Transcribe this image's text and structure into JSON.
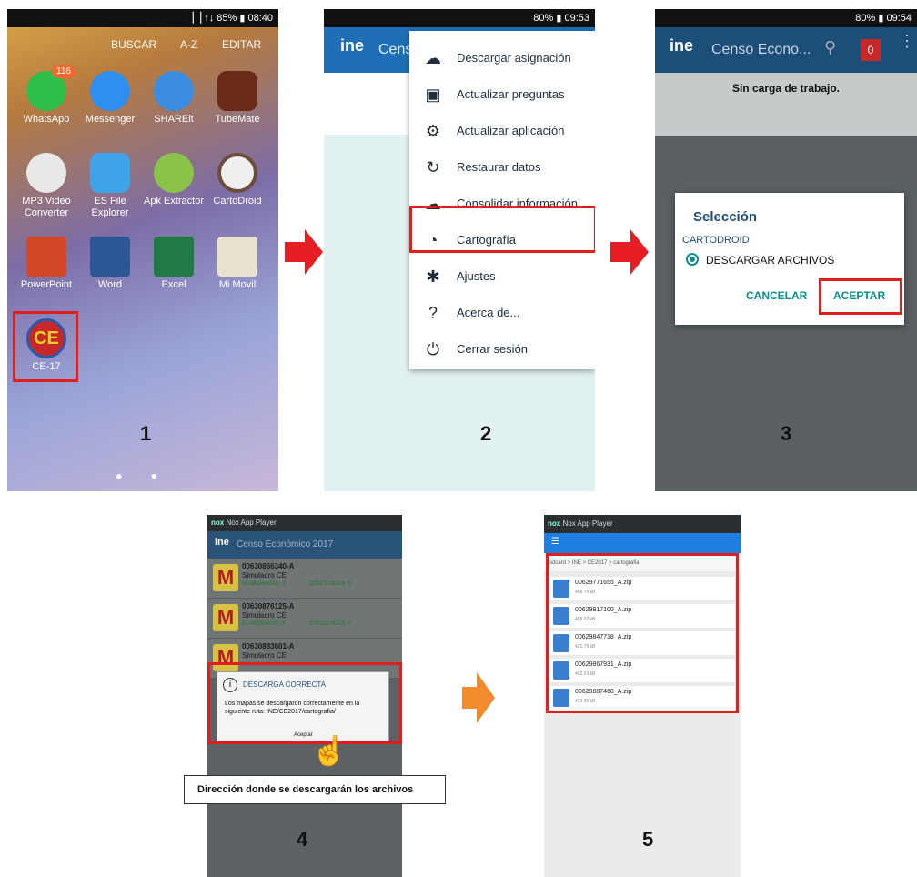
{
  "panel1": {
    "status": "▕▕ ↑↓ 85% ▮ 08:40",
    "topbar": {
      "buscar": "BUSCAR",
      "az": "A-Z",
      "editar": "EDITAR"
    },
    "apps": [
      {
        "label": "WhatsApp",
        "icon": "whatsapp-icon",
        "badge": "116"
      },
      {
        "label": "Messenger",
        "icon": "messenger-icon"
      },
      {
        "label": "SHAREit",
        "icon": "shareit-icon"
      },
      {
        "label": "TubeMate",
        "icon": "tubemate-icon"
      },
      {
        "label": "MP3 Video Converter",
        "icon": "mp3-converter-icon"
      },
      {
        "label": "ES File Explorer",
        "icon": "es-file-explorer-icon"
      },
      {
        "label": "Apk Extractor",
        "icon": "apk-extractor-icon"
      },
      {
        "label": "CartoDroid",
        "icon": "cartodroid-icon"
      },
      {
        "label": "PowerPoint",
        "icon": "powerpoint-icon"
      },
      {
        "label": "Word",
        "icon": "word-icon"
      },
      {
        "label": "Excel",
        "icon": "excel-icon"
      },
      {
        "label": "Mi Movil",
        "icon": "mi-movil-icon"
      }
    ],
    "ce_app": {
      "label": "CE-17",
      "icon_text": "CE"
    },
    "step": "1"
  },
  "panel2": {
    "status": "80% ▮ 09:53",
    "app_title": "Cens",
    "menu": [
      {
        "label": "Descargar asignación",
        "icon": "☁"
      },
      {
        "label": "Actualizar preguntas",
        "icon": "▣"
      },
      {
        "label": "Actualizar aplicación",
        "icon": "⚙"
      },
      {
        "label": "Restaurar datos",
        "icon": "↻"
      },
      {
        "label": "Consolidar información",
        "icon": "☁"
      },
      {
        "label": "Cartografía",
        "icon": "◔"
      },
      {
        "label": "Ajustes",
        "icon": "✱"
      },
      {
        "label": "Acerca de...",
        "icon": "?"
      },
      {
        "label": "Cerrar sesión",
        "icon": "⏻"
      }
    ],
    "step": "2"
  },
  "panel3": {
    "status": "80% ▮ 09:54",
    "app_title": "Censo Econo...",
    "counter": "0",
    "empty_text": "Sin carga de trabajo.",
    "dialog": {
      "title": "Selección",
      "subtitle": "CARTODROID",
      "option": "DESCARGAR ARCHIVOS",
      "cancel": "CANCELAR",
      "accept": "ACEPTAR"
    },
    "step": "3"
  },
  "panel4": {
    "window_title": "Nox App Player",
    "app_title": "Censo Económico 2017",
    "rows": [
      {
        "code": "00630866340-A",
        "name": "Simulacro CE",
        "elab": "ELABORADAS: 0",
        "concl": "CONCLUIDAS: 0"
      },
      {
        "code": "00630876125-A",
        "name": "Simulacro CE",
        "elab": "ELABORADAS: 0",
        "concl": "CONCLUIDAS: 0"
      },
      {
        "code": "00630883601-A",
        "name": "Simulacro CE",
        "elab": "",
        "concl": ""
      }
    ],
    "dialog": {
      "title": "DESCARGA CORRECTA",
      "body": "Los mapas se descargaron correctamente en la siguiente ruta: INE/CE2017/cartografia/",
      "accept": "Aceptar"
    },
    "step": "4"
  },
  "caption": "Dirección donde se descargarán los archivos",
  "panel5": {
    "window_title": "Nox App Player",
    "path": "sdcard  >  INE  >  CE2017  >  cartografia",
    "files": [
      {
        "name": "00629771655_A.zip",
        "size": "488.74 kB"
      },
      {
        "name": "00629817100_A.zip",
        "size": "459.02 kB"
      },
      {
        "name": "00629847718_A.zip",
        "size": "421.79 kB"
      },
      {
        "name": "00629867931_A.zip",
        "size": "402.53 kB"
      },
      {
        "name": "00629887468_A.zip",
        "size": "433.95 kB"
      }
    ],
    "step": "5"
  },
  "colors": {
    "highlight": "#e01e1e",
    "arrow_red": "#e61e24",
    "arrow_orange": "#f28a2e",
    "ine_blue": "#1e6fb5",
    "accept_teal": "#0a8f8f"
  }
}
